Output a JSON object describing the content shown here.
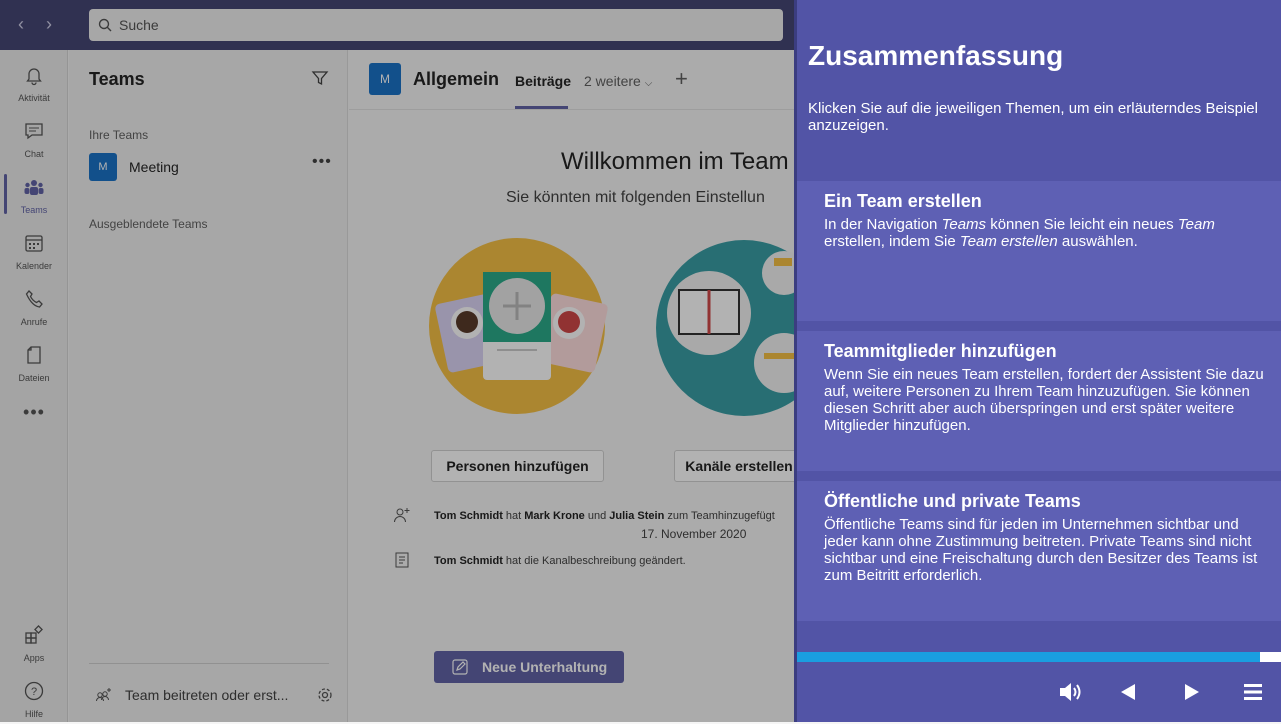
{
  "search": {
    "placeholder": "Suche"
  },
  "rail": [
    {
      "label": "Aktivität",
      "icon": "bell-icon"
    },
    {
      "label": "Chat",
      "icon": "chat-icon"
    },
    {
      "label": "Teams",
      "icon": "teams-icon"
    },
    {
      "label": "Kalender",
      "icon": "calendar-icon"
    },
    {
      "label": "Anrufe",
      "icon": "phone-icon"
    },
    {
      "label": "Dateien",
      "icon": "file-icon"
    },
    {
      "label": "Apps",
      "icon": "apps-icon"
    },
    {
      "label": "Hilfe",
      "icon": "help-icon"
    }
  ],
  "teams_panel": {
    "title": "Teams",
    "your_teams": "Ihre Teams",
    "team": {
      "avatar": "M",
      "name": "Meeting"
    },
    "hidden_teams": "Ausgeblendete Teams",
    "join": "Team beitreten oder erst..."
  },
  "channel": {
    "avatar": "M",
    "name": "Allgemein",
    "tabs": [
      "Beiträge",
      "2 weitere"
    ],
    "welcome": "Willkommen im Team",
    "subtitle": "Sie könnten mit folgenden Einstellun",
    "buttons": [
      "Personen hinzufügen",
      "Kanäle erstellen"
    ],
    "activity": [
      {
        "a": "Tom Schmidt",
        "t1": " hat ",
        "b": "Mark Krone",
        "t2": " und ",
        "c": "Julia Stein",
        "t3": " zum Teamhinzugefügt"
      },
      {
        "a": "Tom Schmidt",
        "t1": " hat die Kanalbeschreibung geändert."
      }
    ],
    "date": "17. November 2020",
    "new_conversation": "Neue Unterhaltung"
  },
  "summary": {
    "title": "Zusammenfassung",
    "intro": "Klicken Sie auf die jeweiligen Themen, um ein erläuterndes Beispiel anzuzeigen.",
    "card1": {
      "heading": "Ein Team erstellen",
      "p1": "In der Navigation ",
      "em1": "Teams",
      "p2": " können Sie leicht ein neues ",
      "em2": "Team",
      "p3": " erstellen, indem Sie ",
      "em3": "Team erstellen",
      "p4": " auswählen."
    },
    "card2": {
      "heading": "Teammitglieder hinzufügen",
      "text": "Wenn Sie ein neues Team erstellen, fordert der Assistent Sie dazu auf, weitere Personen zu Ihrem Team hinzuzufügen. Sie können diesen Schritt aber auch überspringen und erst später weitere Mitglieder hinzufügen."
    },
    "card3": {
      "heading": "Öffentliche und private Teams",
      "text": "Öffentliche Teams sind für jeden im Unternehmen sichtbar und jeder kann ohne Zustimmung beitreten. Private Teams sind nicht sichtbar und eine Freischaltung durch den Besitzer des Teams ist zum Beitritt erforderlich."
    },
    "progress_percent": 95
  },
  "colors": {
    "brand": "#6264a7",
    "panel": "#5254a6",
    "progress": "#1a9ee0",
    "topbar": "#464775"
  }
}
